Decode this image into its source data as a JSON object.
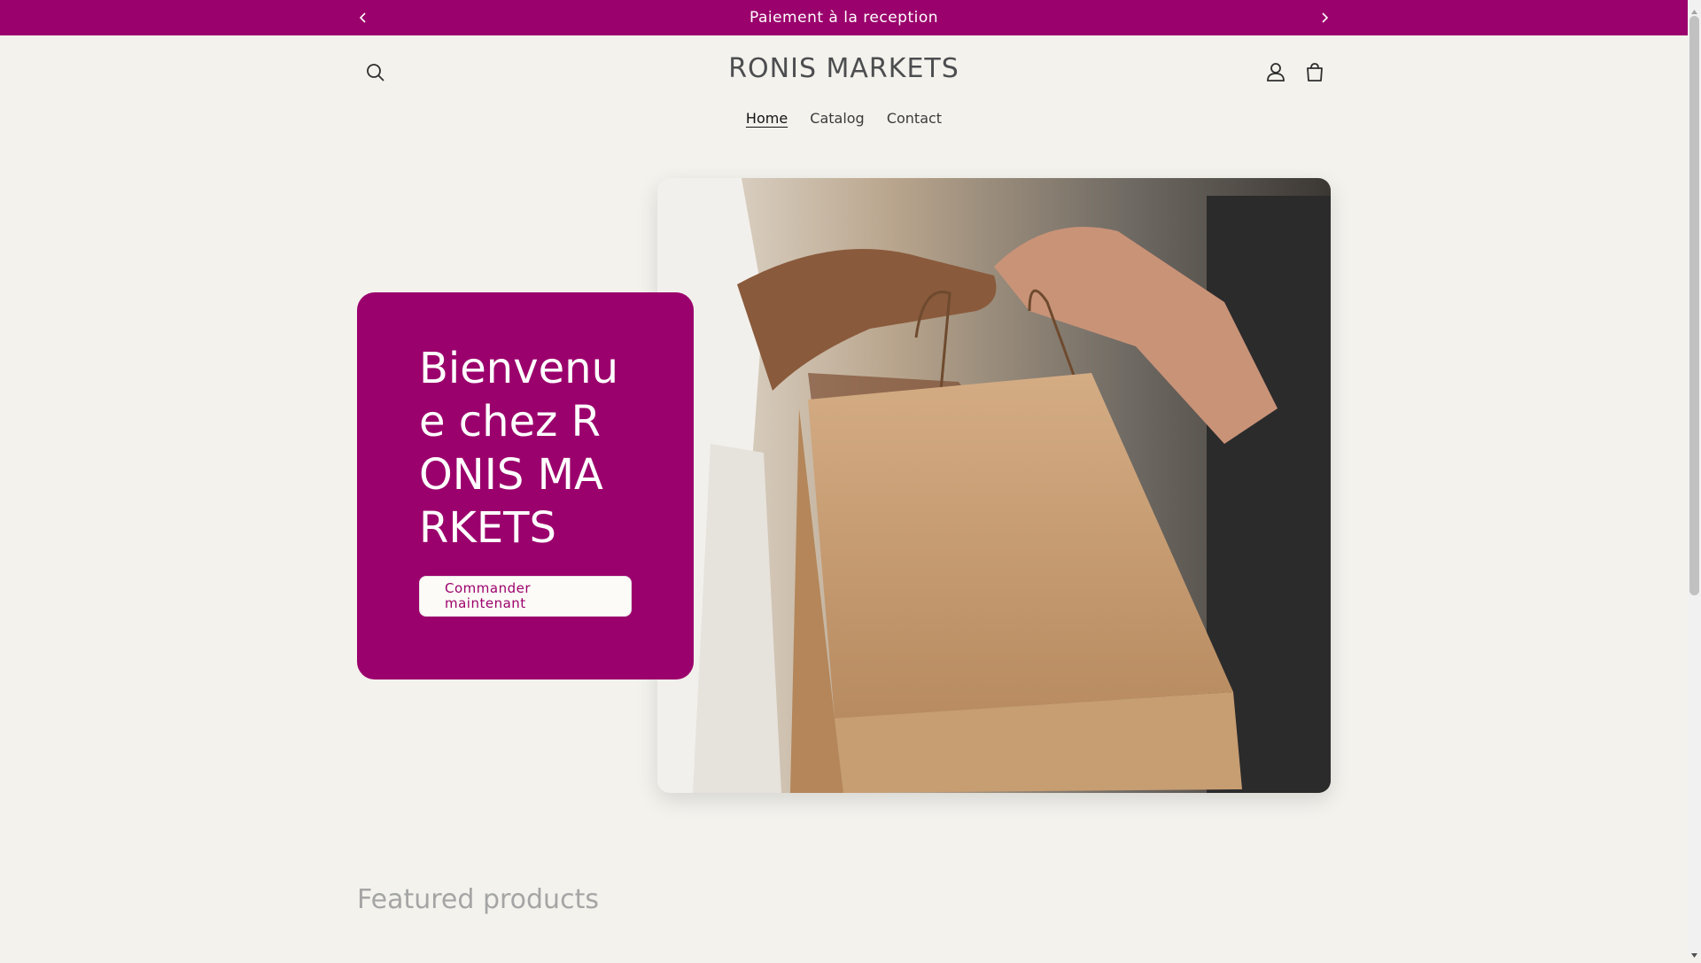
{
  "announcement": {
    "message": "Paiement à la reception",
    "prev_icon": "chevron-left-icon",
    "next_icon": "chevron-right-icon"
  },
  "header": {
    "brand": "RONIS MARKETS",
    "search_icon": "search-icon",
    "account_icon": "user-icon",
    "cart_icon": "cart-icon"
  },
  "nav": {
    "items": [
      {
        "label": "Home",
        "active": true
      },
      {
        "label": "Catalog",
        "active": false
      },
      {
        "label": "Contact",
        "active": false
      }
    ]
  },
  "hero": {
    "title": "Bienvenue chez RONIS MARKETS",
    "button_label": "Commander maintenant",
    "image_alt": "shopping-bag-handover-photo"
  },
  "featured": {
    "heading": "Featured products"
  },
  "colors": {
    "brand": "#9b016c",
    "background": "#f3f2ed"
  }
}
